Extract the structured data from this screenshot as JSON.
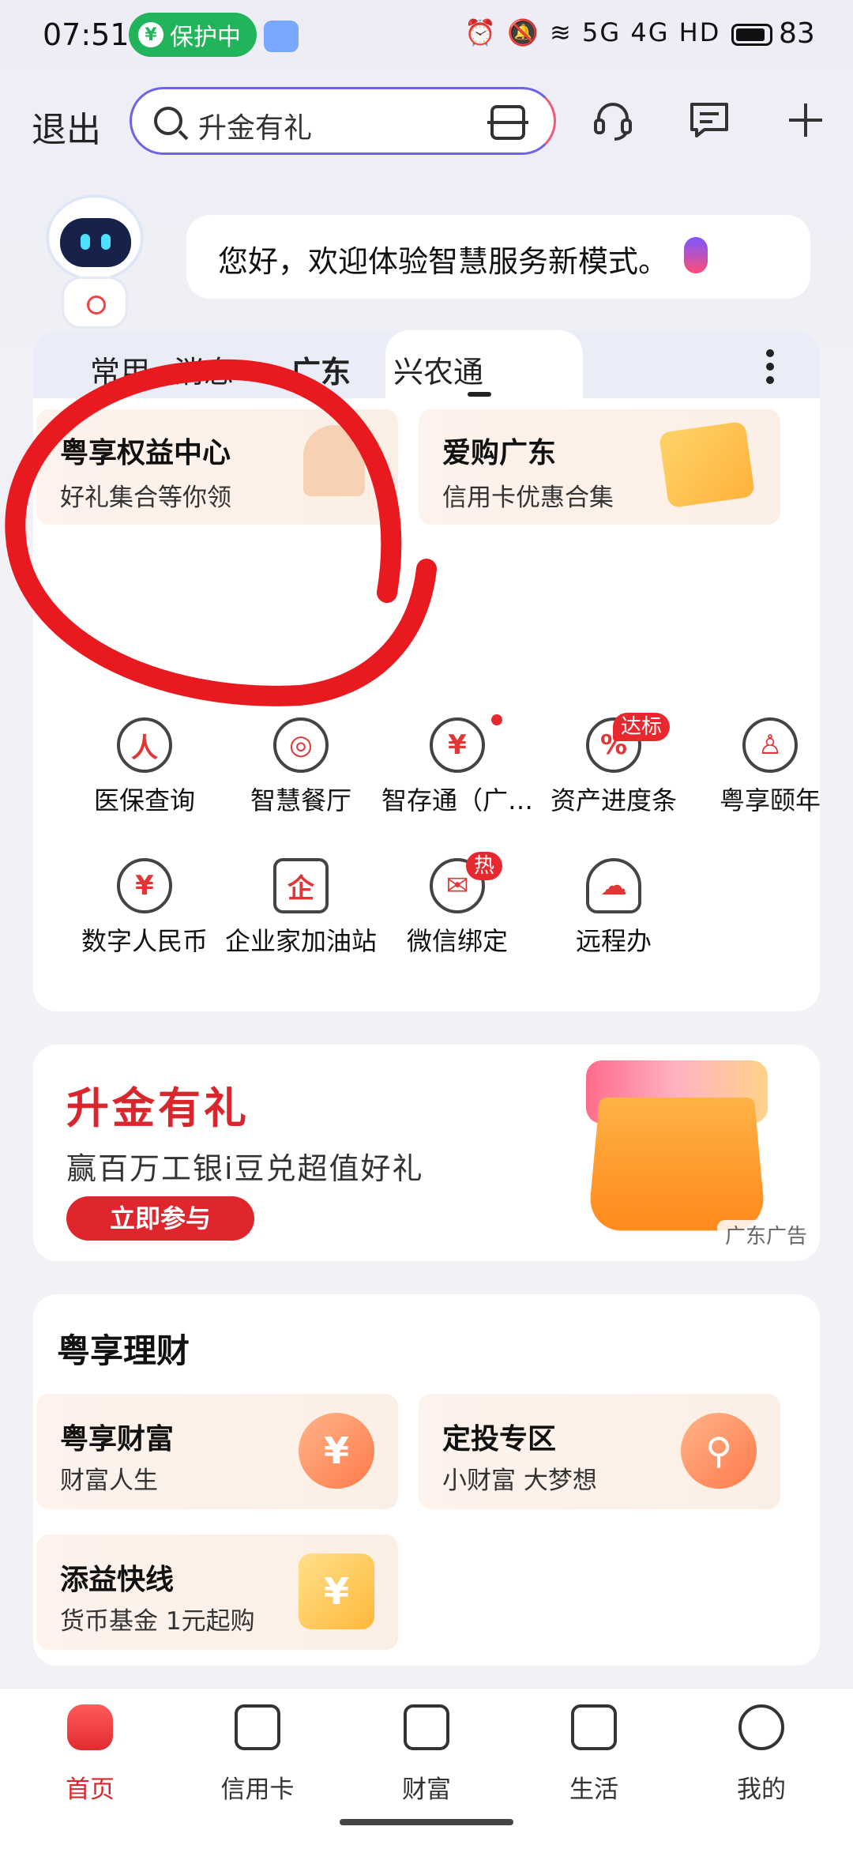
{
  "status_bar": {
    "time": "07:51",
    "protect_label": "保护中",
    "signal_text": "⏰ 🔕 ≋ 5G 4G HD",
    "battery": "83"
  },
  "header": {
    "logout": "退出",
    "search_placeholder": "升金有礼"
  },
  "greeting": {
    "text": "您好，欢迎体验智慧服务新模式。"
  },
  "tabs": [
    {
      "label": "常用"
    },
    {
      "label": "消息"
    },
    {
      "label": "广东"
    },
    {
      "label": "兴农通"
    }
  ],
  "promos": [
    {
      "title": "粤享权益中心",
      "subtitle": "好礼集合等你领"
    },
    {
      "title": "爱购广东",
      "subtitle": "信用卡优惠合集"
    }
  ],
  "services": [
    {
      "label": "医保查询",
      "glyph": "人"
    },
    {
      "label": "智慧餐厅",
      "glyph": "◎"
    },
    {
      "label": "智存通（广…",
      "glyph": "¥"
    },
    {
      "label": "资产进度条",
      "glyph": "%",
      "tag": "达标"
    },
    {
      "label": "粤享颐年",
      "glyph": "♙"
    },
    {
      "label": "数字人民币",
      "glyph": "¥"
    },
    {
      "label": "企业家加油站",
      "glyph": "企"
    },
    {
      "label": "微信绑定",
      "glyph": "✉",
      "tag": "热"
    },
    {
      "label": "远程办",
      "glyph": "☁"
    }
  ],
  "banner": {
    "title": "升金有礼",
    "subtitle": "赢百万工银i豆兑超值好礼",
    "button": "立即参与",
    "ad_label": "广东广告"
  },
  "wealth": {
    "title": "粤享理财",
    "cards": [
      {
        "title": "粤享财富",
        "subtitle": "财富人生",
        "glyph": "¥"
      },
      {
        "title": "定投专区",
        "subtitle": "小财富 大梦想",
        "glyph": "⚲"
      },
      {
        "title": "添益快线",
        "subtitle": "货币基金 1元起购",
        "glyph": "¥"
      }
    ]
  },
  "bottom_nav": [
    {
      "label": "首页",
      "active": true
    },
    {
      "label": "信用卡"
    },
    {
      "label": "财富"
    },
    {
      "label": "生活"
    },
    {
      "label": "我的"
    }
  ],
  "colors": {
    "brand_red": "#d9252c",
    "status_green": "#22b45a",
    "search_border": "#6d63e8"
  }
}
